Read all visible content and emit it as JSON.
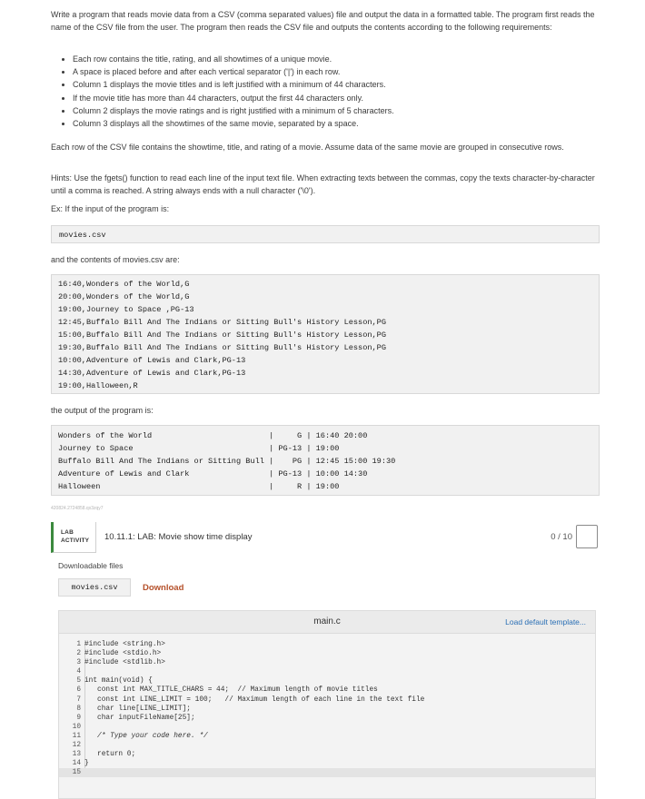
{
  "intro": "Write a program that reads movie data from a CSV (comma separated values) file and output the data in a formatted table. The program first reads the name of the CSV file from the user. The program then reads the CSV file and outputs the contents according to the following requirements:",
  "requirements": [
    "Each row contains the title, rating, and all showtimes of a unique movie.",
    "A space is placed before and after each vertical separator ('|') in each row.",
    "Column 1 displays the movie titles and is left justified with a minimum of 44 characters.",
    "If the movie title has more than 44 characters, output the first 44 characters only.",
    "Column 2 displays the movie ratings and is right justified with a minimum of 5 characters.",
    "Column 3 displays all the showtimes of the same movie, separated by a space."
  ],
  "csv_note": "Each row of the CSV file contains the showtime, title, and rating of a movie. Assume data of the same movie are grouped in consecutive rows.",
  "hints": "Hints: Use the fgets() function to read each line of the input text file. When extracting texts between the commas, copy the texts character-by-character until a comma is reached. A string always ends with a null character ('\\0').",
  "example_label": "Ex: If the input of the program is:",
  "input_example": "movies.csv",
  "contents_label": "and the contents of movies.csv are:",
  "csv_lines": [
    "16:40,Wonders of the World,G",
    "20:00,Wonders of the World,G",
    "19:00,Journey to Space ,PG-13",
    "12:45,Buffalo Bill And The Indians or Sitting Bull's History Lesson,PG",
    "15:00,Buffalo Bill And The Indians or Sitting Bull's History Lesson,PG",
    "19:30,Buffalo Bill And The Indians or Sitting Bull's History Lesson,PG",
    "10:00,Adventure of Lewis and Clark,PG-13",
    "14:30,Adventure of Lewis and Clark,PG-13",
    "19:00,Halloween,R"
  ],
  "output_label": "the output of the program is:",
  "output_lines": [
    "Wonders of the World                         |     G | 16:40 20:00",
    "Journey to Space                             | PG-13 | 19:00",
    "Buffalo Bill And The Indians or Sitting Bull |    PG | 12:45 15:00 19:30",
    "Adventure of Lewis and Clark                 | PG-13 | 10:00 14:30",
    "Halloween                                    |     R | 19:00"
  ],
  "watermark": "420824.2724858.qx3zqy7",
  "lab": {
    "tag_line1": "LAB",
    "tag_line2": "ACTIVITY",
    "title": "10.11.1: LAB: Movie show time display",
    "score": "0 / 10"
  },
  "downloads": {
    "label": "Downloadable files",
    "file": "movies.csv",
    "link": "Download"
  },
  "editor": {
    "filename": "main.c",
    "load_template": "Load default template...",
    "lines": [
      "#include <string.h>",
      "#include <stdio.h>",
      "#include <stdlib.h>",
      "",
      "int main(void) {",
      "   const int MAX_TITLE_CHARS = 44;  // Maximum length of movie titles",
      "   const int LINE_LIMIT = 100;   // Maximum length of each line in the text file",
      "   char line[LINE_LIMIT];",
      "   char inputFileName[25];",
      "",
      "   /* Type your code here. */",
      "",
      "   return 0;",
      "}",
      ""
    ]
  }
}
